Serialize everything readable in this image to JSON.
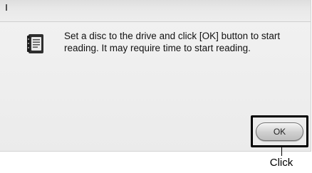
{
  "dialog": {
    "message": "Set a disc to the drive and click [OK] button to start reading. It may require time to start reading.",
    "icon": "app-document-icon",
    "ok_label": "OK"
  },
  "annotation": {
    "label": "Click",
    "highlight_color": "#000000"
  }
}
